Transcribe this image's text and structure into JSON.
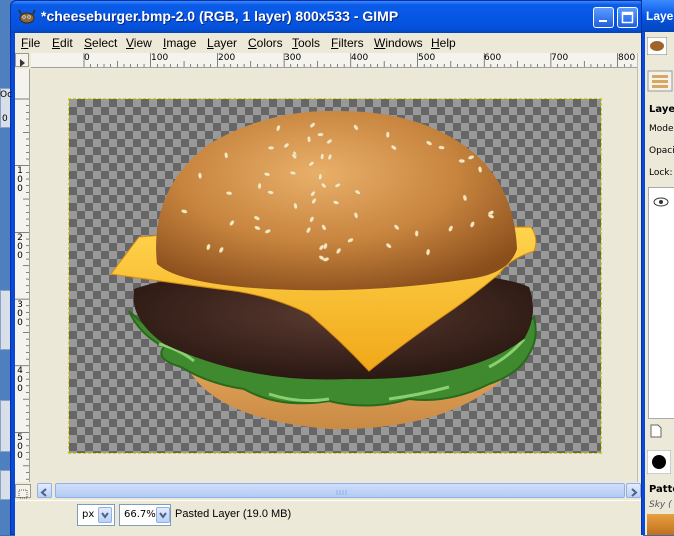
{
  "window": {
    "title": "*cheeseburger.bmp-2.0 (RGB, 1 layer) 800x533 - GIMP"
  },
  "menu": [
    {
      "label": "File",
      "u": "F",
      "rest": "ile"
    },
    {
      "label": "Edit",
      "u": "E",
      "rest": "dit"
    },
    {
      "label": "Select",
      "u": "S",
      "rest": "elect"
    },
    {
      "label": "View",
      "u": "V",
      "rest": "iew"
    },
    {
      "label": "Image",
      "u": "I",
      "rest": "mage"
    },
    {
      "label": "Layer",
      "u": "L",
      "rest": "ayer"
    },
    {
      "label": "Colors",
      "u": "C",
      "rest": "olors"
    },
    {
      "label": "Tools",
      "u": "T",
      "rest": "ools"
    },
    {
      "label": "Filters",
      "u": "F",
      "rest": "ilters"
    },
    {
      "label": "Windows",
      "u": "W",
      "rest": "indows"
    },
    {
      "label": "Help",
      "u": "H",
      "rest": "elp"
    }
  ],
  "ruler": {
    "h_labels": [
      "0",
      "100",
      "200",
      "300",
      "400",
      "500",
      "600",
      "700",
      "800"
    ],
    "v_labels": [
      "1 0 0",
      "2 0 0",
      "3 0 0",
      "4 0 0",
      "5 0 0"
    ]
  },
  "status": {
    "unit": "px",
    "zoom": "66.7%",
    "message": "Pasted Layer (19.0 MB)"
  },
  "dock": {
    "title": "Laye",
    "tab_label": "Laye",
    "mode_label": "Mode",
    "opacity_label": "Opaci",
    "lock_label": "Lock:",
    "patterns_label": "Patte",
    "pattern_name": "Sky (",
    "left_strip_labels": [
      "Oc",
      "0"
    ]
  }
}
